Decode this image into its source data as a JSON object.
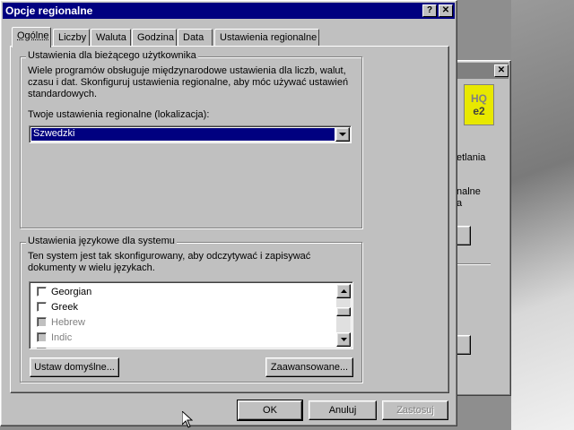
{
  "background_window": {
    "partial_texts": [
      "etlania",
      "nalne",
      "a"
    ],
    "logo_text_top": "HQ",
    "logo_text_bottom": "e2"
  },
  "dialog": {
    "title": "Opcje regionalne",
    "help_button": "?",
    "close_button": "✕",
    "tabs": [
      {
        "label": "Ogólne",
        "active": true
      },
      {
        "label": "Liczby",
        "active": false
      },
      {
        "label": "Waluta",
        "active": false
      },
      {
        "label": "Godzina",
        "active": false
      },
      {
        "label": "Data",
        "active": false
      },
      {
        "label": "Ustawienia regionalne",
        "active": false
      }
    ],
    "user_settings": {
      "group_title": "Ustawienia dla bieżącego użytkownika",
      "description": "Wiele programów obsługuje międzynarodowe ustawienia dla liczb, walut, czasu i dat. Skonfiguruj ustawienia regionalne, aby móc używać ustawień standardowych.",
      "locale_label": "Twoje ustawienia regionalne (lokalizacja):",
      "locale_value": "Szwedzki"
    },
    "language_settings": {
      "group_title": "Ustawienia językowe dla systemu",
      "description": "Ten system jest tak skonfigurowany, aby odczytywać i zapisywać dokumenty w wielu językach.",
      "languages": [
        {
          "label": "Georgian",
          "enabled": true
        },
        {
          "label": "Greek",
          "enabled": true
        },
        {
          "label": "Hebrew",
          "enabled": false
        },
        {
          "label": "Indic",
          "enabled": false
        }
      ],
      "set_default_button": "Ustaw domyślne...",
      "advanced_button": "Zaawansowane..."
    },
    "ok_button": "OK",
    "cancel_button": "Anuluj",
    "apply_button": "Zastosuj"
  },
  "colors": {
    "title_bar": "#000080",
    "selection": "#000080",
    "face": "#c0c0c0",
    "logo_yellow": "#e8e800"
  }
}
